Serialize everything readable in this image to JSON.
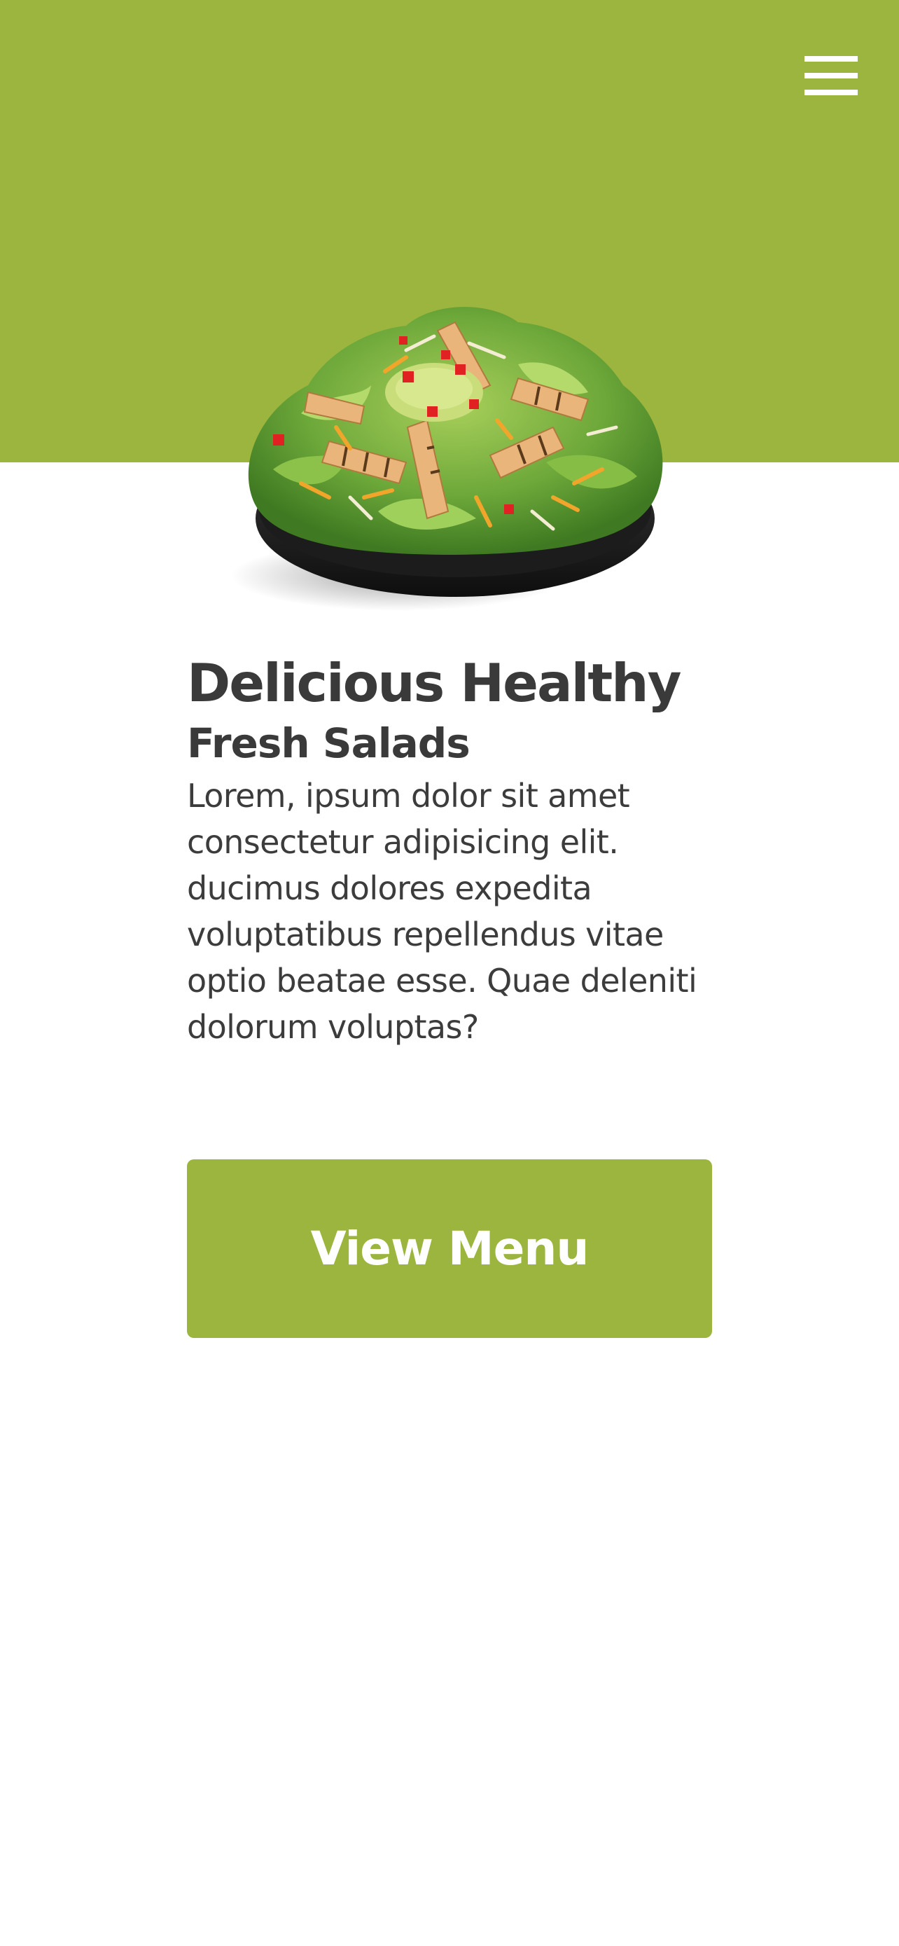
{
  "colors": {
    "brand_green": "#9bb53f",
    "text_dark": "#3a3a3a",
    "background": "#ffffff"
  },
  "header": {
    "menu_icon": "hamburger-menu-icon"
  },
  "hero": {
    "image": "salad-bowl-image"
  },
  "main": {
    "headline": "Delicious Healthy",
    "subheadline": "Fresh Salads",
    "body": "Lorem, ipsum dolor sit amet consectetur adipisicing elit. ducimus dolores expedita voluptatibus repellendus vitae optio beatae esse. Quae deleniti dolorum voluptas?",
    "cta_label": "View Menu"
  }
}
